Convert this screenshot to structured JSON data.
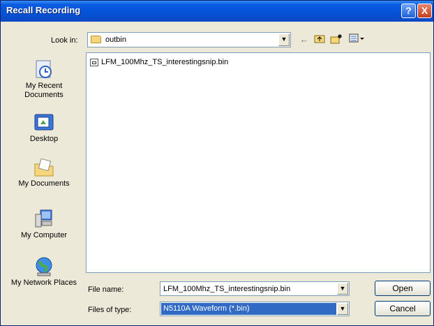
{
  "window": {
    "title": "Recall Recording",
    "help_icon": "?",
    "close_icon": "X"
  },
  "lookin": {
    "label": "Look in:",
    "value": "outbin"
  },
  "toolbar": {
    "back_icon": "arrow-left-icon",
    "up_icon": "folder-up-icon",
    "new_folder_icon": "new-folder-icon",
    "views_icon": "views-menu-icon"
  },
  "places": [
    {
      "label": "My Recent Documents",
      "icon": "recent-documents-icon"
    },
    {
      "label": "Desktop",
      "icon": "desktop-icon"
    },
    {
      "label": "My Documents",
      "icon": "my-documents-icon"
    },
    {
      "label": "My Computer",
      "icon": "my-computer-icon"
    },
    {
      "label": "My Network Places",
      "icon": "network-places-icon"
    }
  ],
  "files": [
    {
      "name": "LFM_100Mhz_TS_interestingsnip.bin"
    }
  ],
  "filename": {
    "label": "File name:",
    "value": "LFM_100Mhz_TS_interestingsnip.bin"
  },
  "filetype": {
    "label": "Files of type:",
    "value": "N5110A Waveform (*.bin)"
  },
  "buttons": {
    "open": "Open",
    "cancel": "Cancel"
  },
  "colors": {
    "titlebar": "#0552D6",
    "selection": "#316AC5",
    "face": "#ECE9D8"
  }
}
